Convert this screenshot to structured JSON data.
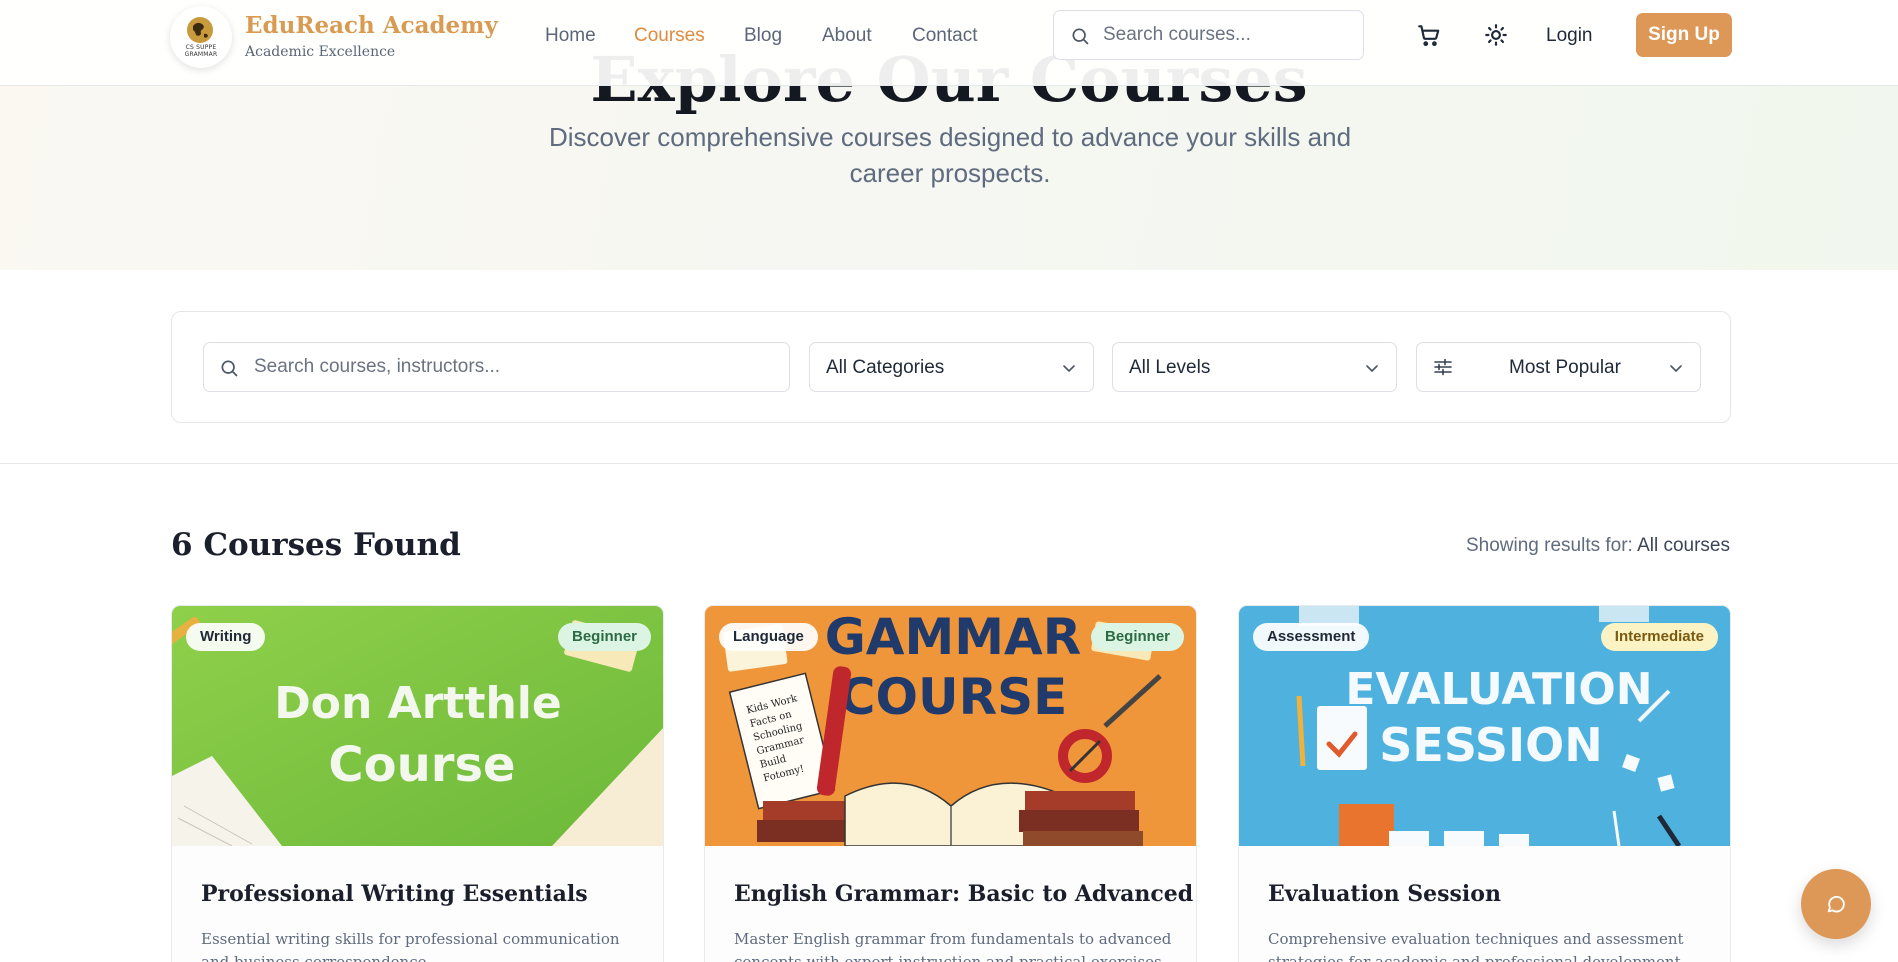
{
  "brand": {
    "name": "EduReach Academy",
    "tagline": "Academic Excellence",
    "logo_text": "CS SUPPE GRAMMAR"
  },
  "nav": {
    "links": [
      {
        "label": "Home",
        "active": false
      },
      {
        "label": "Courses",
        "active": true
      },
      {
        "label": "Blog",
        "active": false
      },
      {
        "label": "About",
        "active": false
      },
      {
        "label": "Contact",
        "active": false
      }
    ],
    "search_placeholder": "Search courses...",
    "cart_icon": "cart-icon",
    "theme_icon": "sun-icon",
    "login_label": "Login",
    "signup_label": "Sign Up"
  },
  "hero": {
    "title": "Explore Our Courses",
    "subtitle": "Discover comprehensive courses designed to advance your skills and career prospects."
  },
  "filters": {
    "search_placeholder": "Search courses, instructors...",
    "category": "All Categories",
    "level": "All Levels",
    "sort": "Most Popular"
  },
  "results": {
    "count_label": "6 Courses Found",
    "info_prefix": "Showing results for: ",
    "info_value": "All courses"
  },
  "courses": [
    {
      "category": "Writing",
      "level": "Beginner",
      "image_text": [
        "Don Artthle",
        "Course"
      ],
      "title": "Professional Writing Essentials",
      "description": "Essential writing skills for professional communication and business correspondence."
    },
    {
      "category": "Language",
      "level": "Beginner",
      "image_text": [
        "GAMMAR",
        "COURSE"
      ],
      "image_note": [
        "Kids Work",
        "Facts on",
        "Schooling",
        "Grammar",
        "Build",
        "Fotomy!"
      ],
      "title": "English Grammar: Basic to Advanced",
      "description": "Master English grammar from fundamentals to advanced concepts with expert instruction and practical exercises."
    },
    {
      "category": "Assessment",
      "level": "Intermediate",
      "image_text": [
        "EVALUATION",
        "SESSION"
      ],
      "title": "Evaluation Session",
      "description": "Comprehensive evaluation techniques and assessment strategies for academic and professional development."
    }
  ],
  "colors": {
    "accent": "#dd9757",
    "active_link": "#de8a3f",
    "brand_text": "#d99a52",
    "beginner_badge": "#dcf4e4",
    "intermediate_badge": "#fbf3c4"
  },
  "chat_icon": "chat-icon"
}
